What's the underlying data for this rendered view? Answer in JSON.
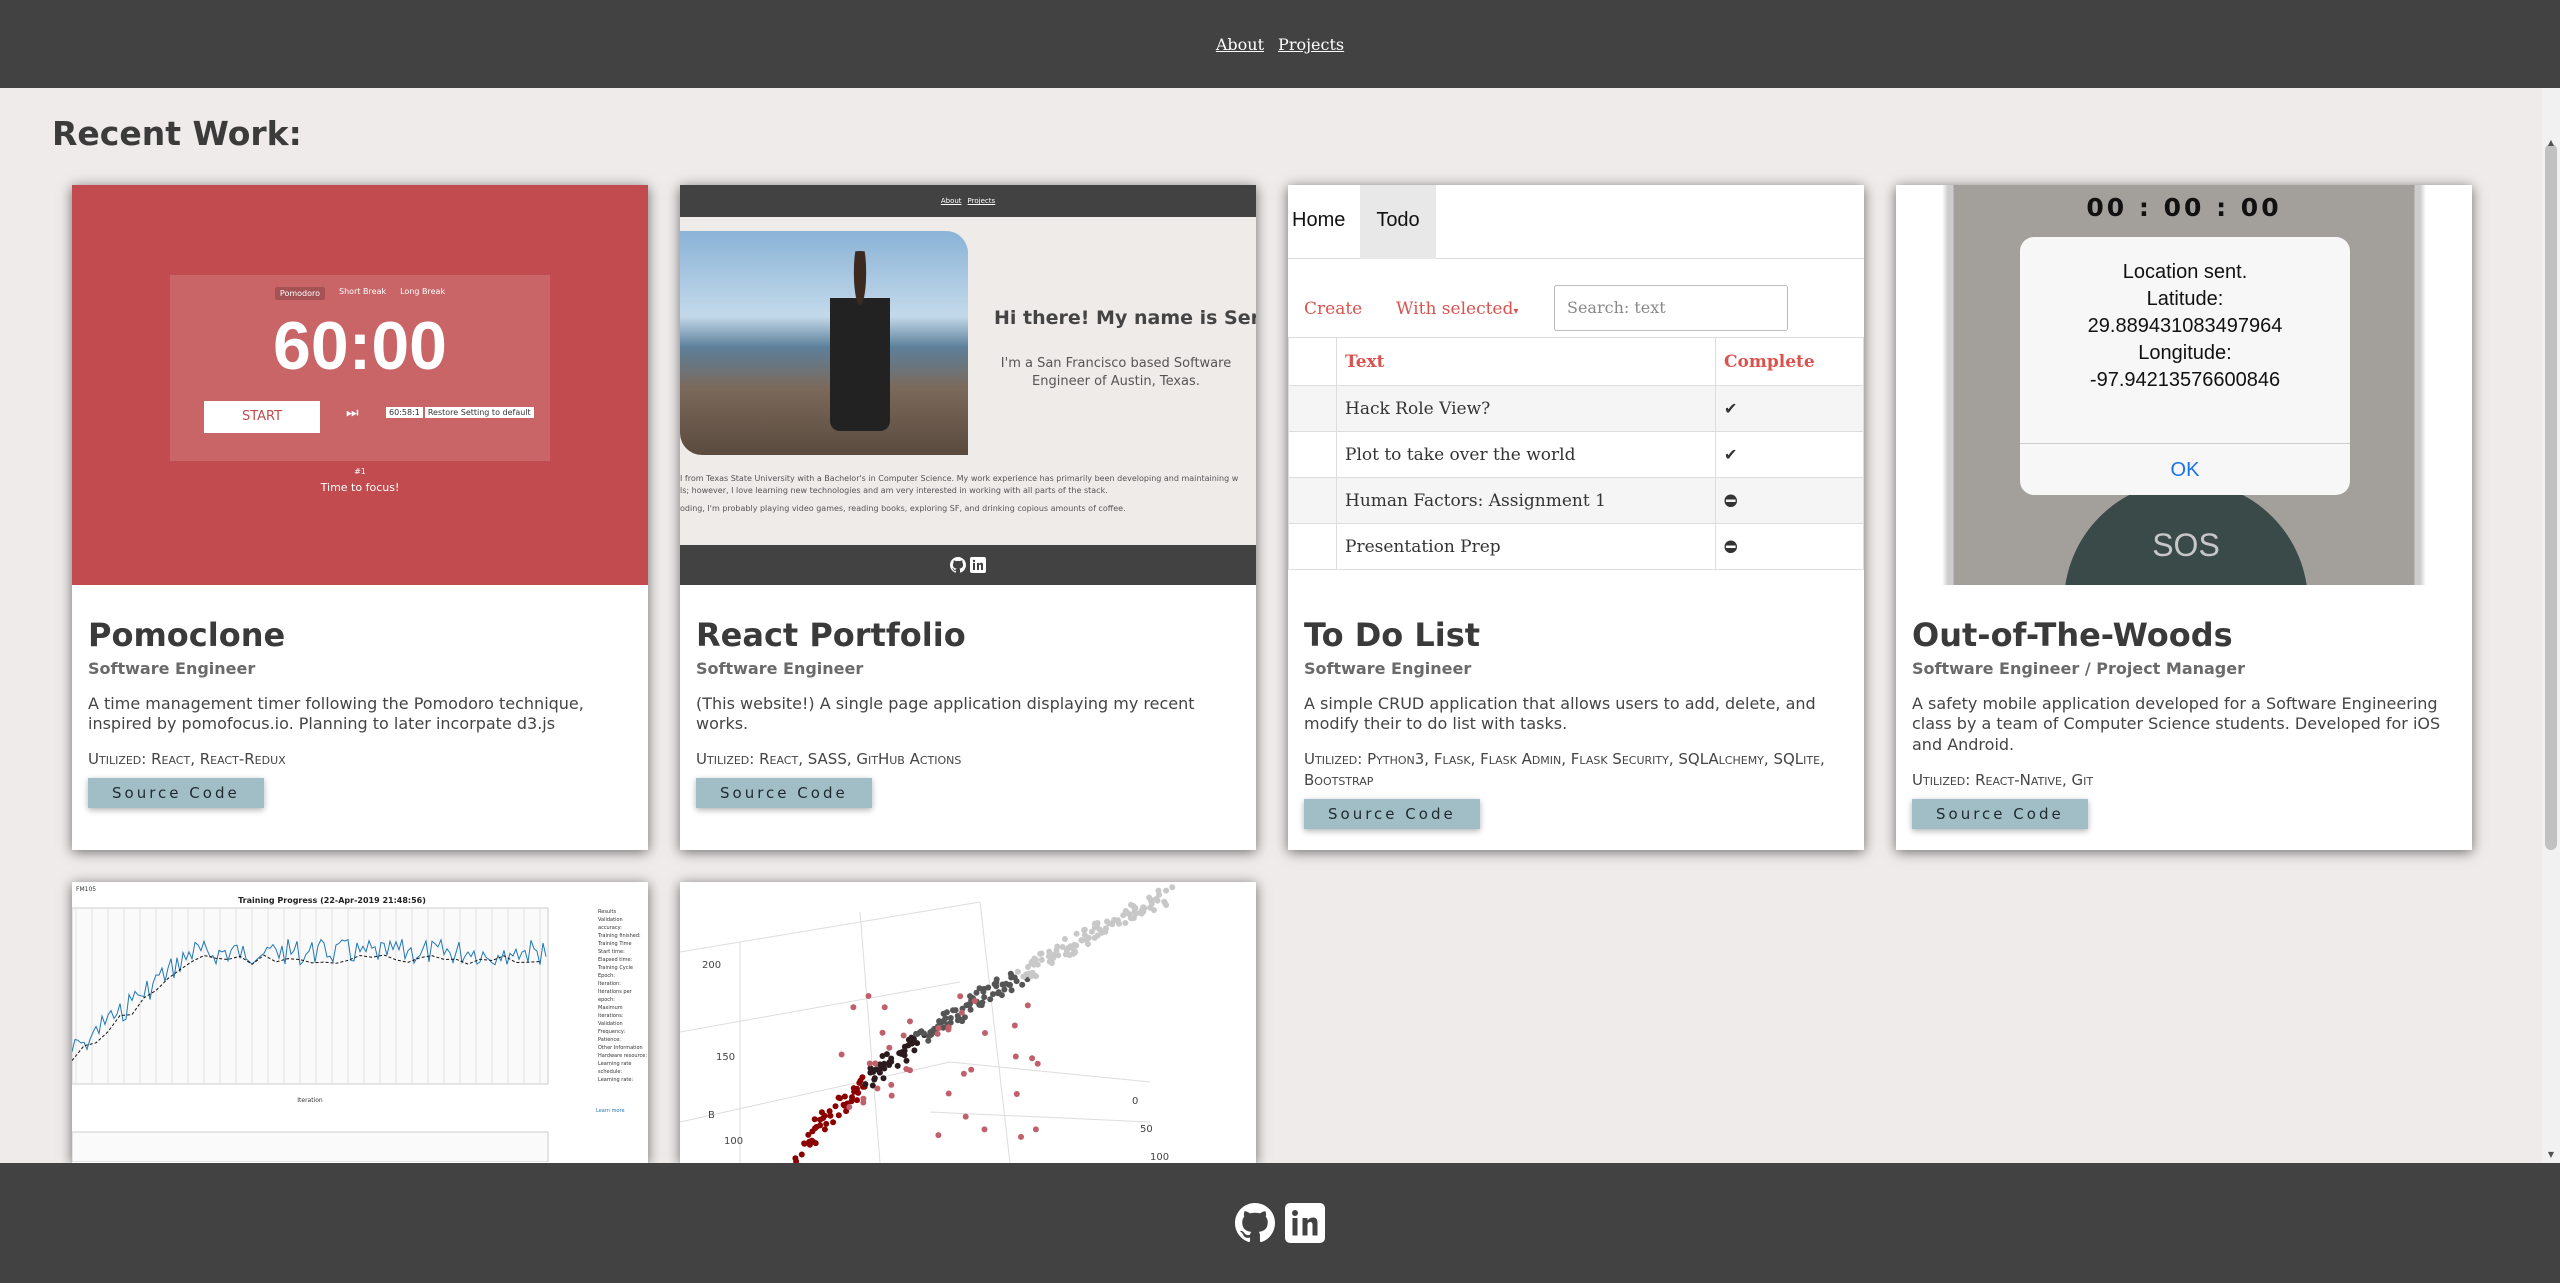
{
  "nav": {
    "about": "About",
    "projects": "Projects"
  },
  "heading": "Recent Work:",
  "projects": [
    {
      "title": "Pomoclone",
      "role": "Software Engineer",
      "description": "A time management timer following the Pomodoro technique, inspired by pomofocus.io. Planning to later incorpate d3.js",
      "utilized": "Utilized: React, React-Redux",
      "button": "Source Code",
      "screenshot": {
        "tabs": [
          "Pomodoro",
          "Short Break",
          "Long Break"
        ],
        "time": "60:00",
        "start": "START",
        "inputs": [
          "60:58:1",
          "Restore Setting to default"
        ],
        "count": "#1",
        "message": "Time to focus!"
      }
    },
    {
      "title": "React Portfolio",
      "role": "Software Engineer",
      "description": "(This website!) A single page application displaying my recent works.",
      "utilized": "Utilized: React, SASS, GitHub Actions",
      "button": "Source Code",
      "screenshot": {
        "nav": [
          "About",
          "Projects"
        ],
        "greeting": "Hi there! My name is Seren",
        "subtitle": "I'm a San Francisco based Software Engineer of Austin, Texas.",
        "para1": "I from Texas State University with a Bachelor's in Computer Science. My work experience has primarily been developing and maintaining w",
        "para2": "ls; however, I love learning new technologies and am very interested in working with all parts of the stack.",
        "para3": "oding, I'm probably playing video games, reading books, exploring SF, and drinking copious amounts of coffee."
      }
    },
    {
      "title": "To Do List",
      "role": "Software Engineer",
      "description": "A simple CRUD application that allows users to add, delete, and modify their to do list with tasks.",
      "utilized": "Utilized: Python3, Flask, Flask Admin, Flask Security, SQLAlchemy, SQLite, Bootstrap",
      "button": "Source Code",
      "screenshot": {
        "nav": [
          "Home",
          "Todo"
        ],
        "create": "Create",
        "with_selected": "With selected",
        "search_placeholder": "Search: text",
        "headers": [
          "Text",
          "Complete"
        ],
        "rows": [
          {
            "text": "Hack Role View?",
            "complete": true
          },
          {
            "text": "Plot to take over the world",
            "complete": true
          },
          {
            "text": "Human Factors: Assignment 1",
            "complete": false
          },
          {
            "text": "Presentation Prep",
            "complete": false
          }
        ]
      }
    },
    {
      "title": "Out-of-The-Woods",
      "role": "Software Engineer / Project Manager",
      "description": "A safety mobile application developed for a Software Engineering class by a team of Computer Science students. Developed for iOS and Android.",
      "utilized": "Utilized: React-Native, Git",
      "button": "Source Code",
      "screenshot": {
        "clock": "00 : 00 : 00",
        "line1": "Location sent.",
        "line2": "Latitude:",
        "line3": "29.889431083497964",
        "line4": "Longitude:",
        "line5": "-97.94213576600846",
        "ok": "OK",
        "sos": "SOS"
      }
    }
  ],
  "training": {
    "tag": "FM105",
    "title": "Training Progress (22-Apr-2019 21:48:56)",
    "side": [
      "Results",
      "Validation accuracy:",
      "Training finished:",
      "Training Time",
      "Start time:",
      "Elapsed time:",
      "Training Cycle",
      "Epoch:",
      "Iteration:",
      "Iterations per epoch:",
      "Maximum iterations:",
      "Validation",
      "Frequency:",
      "Patience:",
      "Other Information",
      "Hardware resource:",
      "Learning rate schedule:",
      "Learning rate:"
    ],
    "learn_more": "Learn more",
    "x_label": "Iteration"
  },
  "scatter": {
    "axis_labels": [
      "200",
      "150",
      "B",
      "100",
      "0",
      "50",
      "100"
    ]
  },
  "footer": {
    "icons": [
      "github-icon",
      "linkedin-icon"
    ]
  },
  "colors": {
    "topbar": "#424242",
    "pomo": "#c14b4e",
    "button": "#a1bec7",
    "todo_accent": "#d9534f",
    "ios_blue": "#1a73e8"
  }
}
